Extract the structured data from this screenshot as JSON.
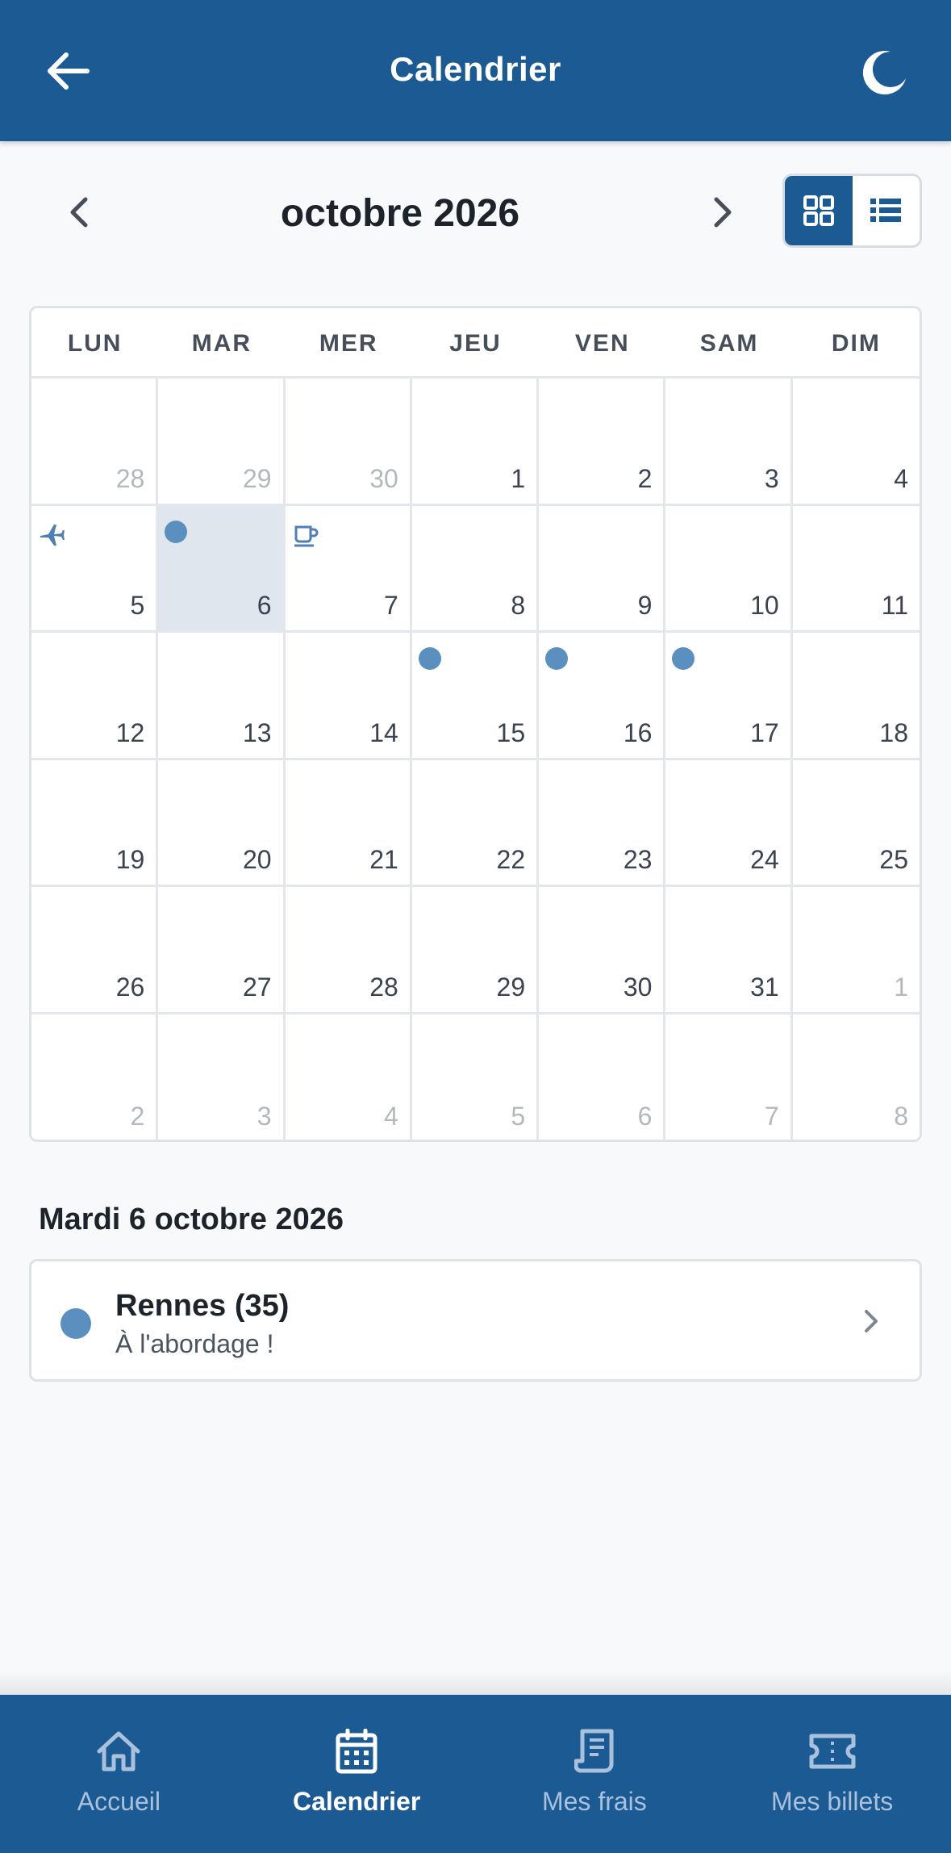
{
  "header": {
    "title": "Calendrier",
    "back_icon": "arrow-left-icon",
    "theme_icon": "moon-icon"
  },
  "month_nav": {
    "label": "octobre 2026",
    "prev_icon": "chevron-left-icon",
    "next_icon": "chevron-right-icon",
    "view_options": [
      {
        "icon": "grid-view-icon",
        "active": true
      },
      {
        "icon": "list-view-icon",
        "active": false
      }
    ]
  },
  "calendar": {
    "weekdays": [
      "LUN",
      "MAR",
      "MER",
      "JEU",
      "VEN",
      "SAM",
      "DIM"
    ],
    "weeks": [
      [
        {
          "day": "28",
          "muted": true
        },
        {
          "day": "29",
          "muted": true
        },
        {
          "day": "30",
          "muted": true
        },
        {
          "day": "1"
        },
        {
          "day": "2"
        },
        {
          "day": "3"
        },
        {
          "day": "4"
        }
      ],
      [
        {
          "day": "5",
          "marker": "plane-icon"
        },
        {
          "day": "6",
          "marker": "dot",
          "selected": true
        },
        {
          "day": "7",
          "marker": "coffee-icon"
        },
        {
          "day": "8"
        },
        {
          "day": "9"
        },
        {
          "day": "10"
        },
        {
          "day": "11"
        }
      ],
      [
        {
          "day": "12"
        },
        {
          "day": "13"
        },
        {
          "day": "14"
        },
        {
          "day": "15",
          "marker": "dot"
        },
        {
          "day": "16",
          "marker": "dot"
        },
        {
          "day": "17",
          "marker": "dot"
        },
        {
          "day": "18"
        }
      ],
      [
        {
          "day": "19"
        },
        {
          "day": "20"
        },
        {
          "day": "21"
        },
        {
          "day": "22"
        },
        {
          "day": "23"
        },
        {
          "day": "24"
        },
        {
          "day": "25"
        }
      ],
      [
        {
          "day": "26"
        },
        {
          "day": "27"
        },
        {
          "day": "28"
        },
        {
          "day": "29"
        },
        {
          "day": "30"
        },
        {
          "day": "31"
        },
        {
          "day": "1",
          "muted": true
        }
      ],
      [
        {
          "day": "2",
          "muted": true
        },
        {
          "day": "3",
          "muted": true
        },
        {
          "day": "4",
          "muted": true
        },
        {
          "day": "5",
          "muted": true
        },
        {
          "day": "6",
          "muted": true
        },
        {
          "day": "7",
          "muted": true
        },
        {
          "day": "8",
          "muted": true
        }
      ]
    ]
  },
  "selected_day": {
    "heading": "Mardi 6 octobre 2026",
    "events": [
      {
        "title": "Rennes (35)",
        "subtitle": "À l'abordage !",
        "color": "#5a8fc0"
      }
    ]
  },
  "bottom_nav": {
    "items": [
      {
        "label": "Accueil",
        "icon": "home-icon",
        "active": false
      },
      {
        "label": "Calendrier",
        "icon": "calendar-icon",
        "active": true
      },
      {
        "label": "Mes frais",
        "icon": "receipt-icon",
        "active": false
      },
      {
        "label": "Mes billets",
        "icon": "ticket-icon",
        "active": false
      }
    ]
  },
  "colors": {
    "primary": "#1c5a93",
    "event_dot": "#5a8fc0",
    "selected_cell": "#dfe6ee",
    "inactive_nav": "#a9c1dc"
  }
}
